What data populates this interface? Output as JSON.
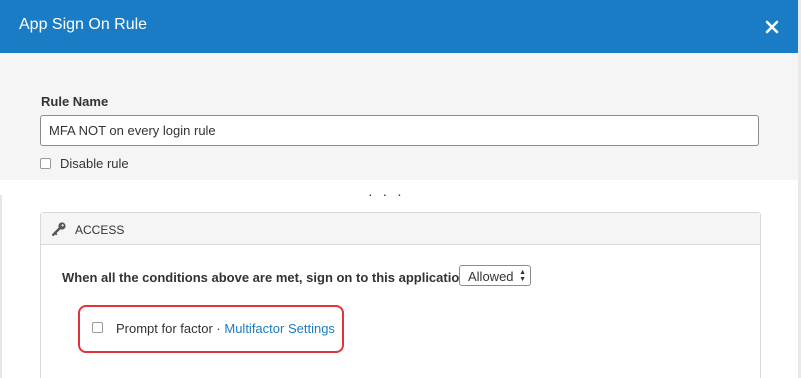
{
  "modal": {
    "title": "App Sign On Rule",
    "close_icon": "close-icon",
    "header_color": "#1a7cc4"
  },
  "rule_name": {
    "label": "Rule Name",
    "value": "MFA NOT on every login rule"
  },
  "disable_rule": {
    "label": "Disable rule",
    "checked": false
  },
  "collapsed_indicator": "· · ·",
  "access": {
    "icon": "key-icon",
    "title": "ACCESS",
    "condition_text": "When all the conditions above are met, sign on to this application is:",
    "select": {
      "value": "Allowed",
      "arrows": "▲▼"
    },
    "prompt_for_factor": {
      "label": "Prompt for factor",
      "separator": " · ",
      "link": "Multifactor Settings",
      "link_color": "#1a7cc4",
      "checked": false
    },
    "highlight_color": "#e0343a"
  }
}
